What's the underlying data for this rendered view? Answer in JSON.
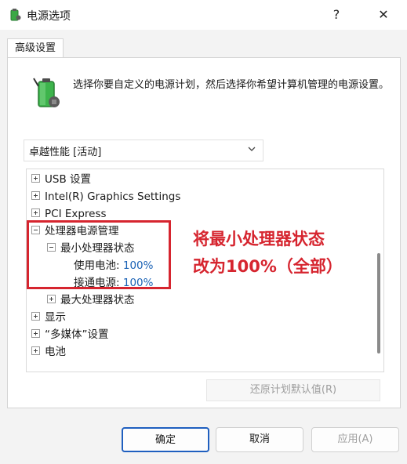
{
  "window": {
    "title": "电源选项",
    "help_glyph": "?",
    "close_glyph": "✕"
  },
  "tabs": [
    {
      "label": "高级设置"
    }
  ],
  "description": "选择你要自定义的电源计划，然后选择你希望计算机管理的电源设置。",
  "plan_select": {
    "value": "卓越性能 [活动]"
  },
  "tree": {
    "items": [
      {
        "label": "USB 设置"
      },
      {
        "label": "Intel(R) Graphics Settings"
      },
      {
        "label": "PCI Express"
      },
      {
        "label": "处理器电源管理"
      },
      {
        "label": "最小处理器状态"
      },
      {
        "label": "使用电池:",
        "value": "100%"
      },
      {
        "label": "接通电源:",
        "value": "100%"
      },
      {
        "label": "最大处理器状态"
      },
      {
        "label": "显示"
      },
      {
        "label": "“多媒体”设置"
      },
      {
        "label": "电池"
      }
    ]
  },
  "annotation": {
    "line1": "将最小处理器状态",
    "line2": "改为100%（全部）",
    "color": "#d6252f"
  },
  "buttons": {
    "restore": "还原计划默认值(R)",
    "ok": "确定",
    "cancel": "取消",
    "apply": "应用(A)"
  },
  "icons": [
    "power-options-app-icon",
    "battery-plug-icon",
    "chevron-down-icon",
    "expand-icon",
    "collapse-icon",
    "close-icon"
  ]
}
